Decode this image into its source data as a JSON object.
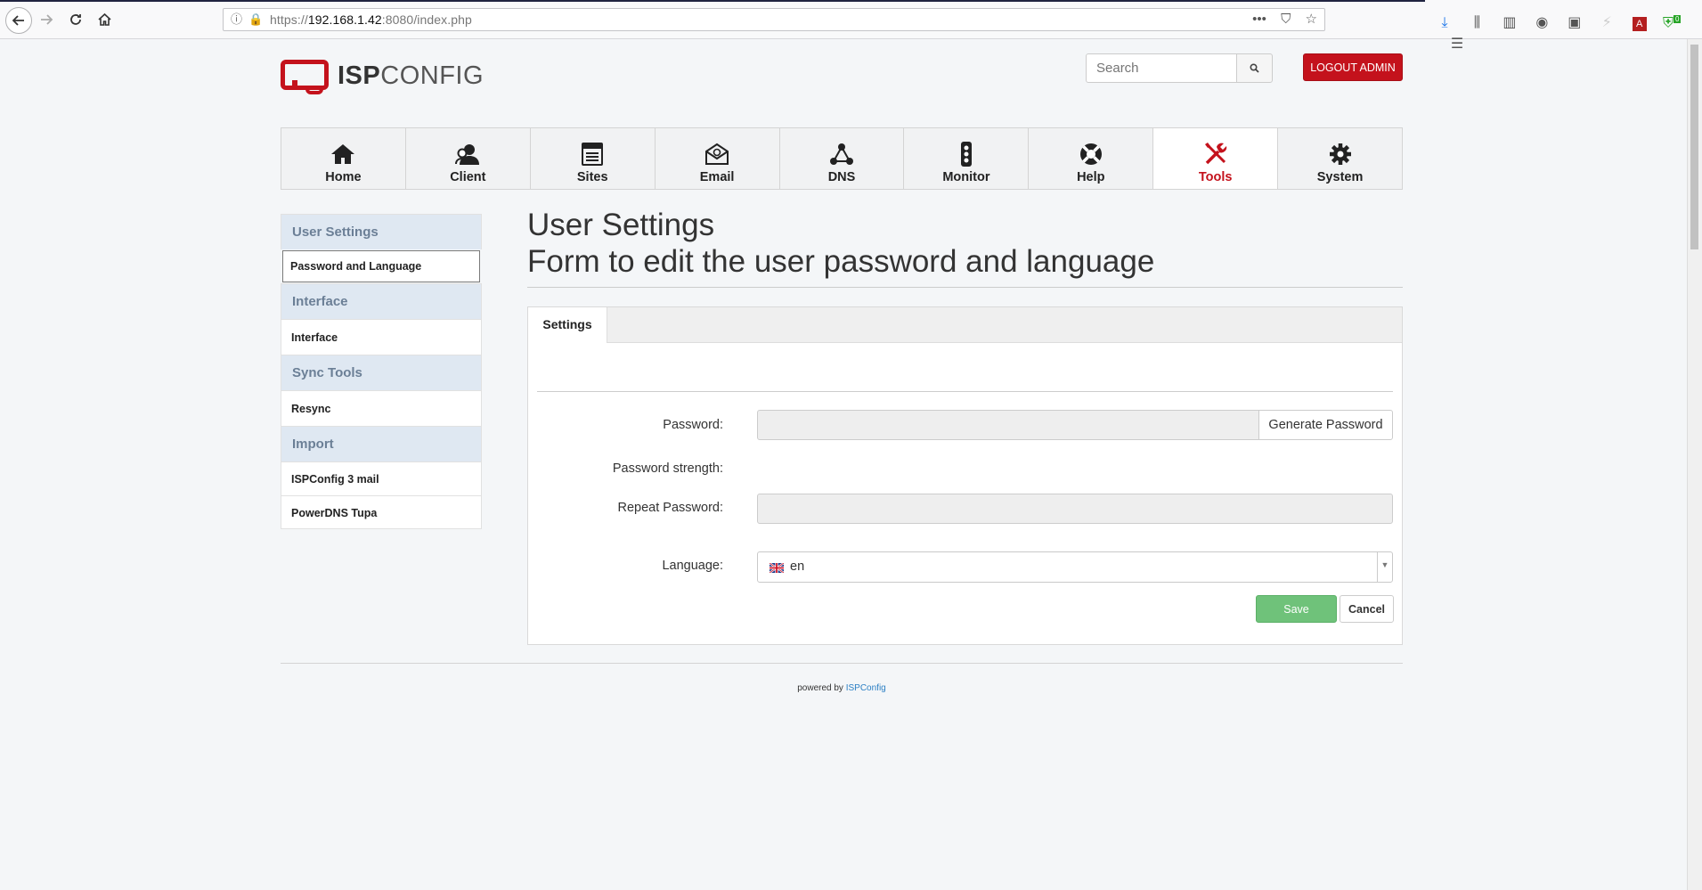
{
  "browser": {
    "url_prefix": "https://",
    "url_host": "192.168.1.42",
    "url_rest": ":8080/index.php",
    "more_icon": "ellipsis-icon",
    "pocket_icon": "pocket-icon",
    "bookmark_icon": "star-icon",
    "extension_badge": "0"
  },
  "header": {
    "logo_bold": "ISP",
    "logo_light": "CONFIG",
    "search_placeholder": "Search",
    "logout_label": "LOGOUT ADMIN"
  },
  "nav": [
    {
      "label": "Home",
      "icon": "home-icon"
    },
    {
      "label": "Client",
      "icon": "client-icon"
    },
    {
      "label": "Sites",
      "icon": "sites-icon"
    },
    {
      "label": "Email",
      "icon": "email-icon"
    },
    {
      "label": "DNS",
      "icon": "dns-icon"
    },
    {
      "label": "Monitor",
      "icon": "monitor-icon"
    },
    {
      "label": "Help",
      "icon": "help-icon"
    },
    {
      "label": "Tools",
      "icon": "tools-icon",
      "active": true
    },
    {
      "label": "System",
      "icon": "system-icon"
    }
  ],
  "sidebar": {
    "sections": [
      {
        "title": "User Settings",
        "items": [
          "Password and Language"
        ]
      },
      {
        "title": "Interface",
        "items": [
          "Interface"
        ]
      },
      {
        "title": "Sync Tools",
        "items": [
          "Resync"
        ]
      },
      {
        "title": "Import",
        "items": [
          "ISPConfig 3 mail",
          "PowerDNS Tupa"
        ]
      }
    ]
  },
  "page": {
    "title": "User Settings",
    "subtitle": "Form to edit the user password and language"
  },
  "form": {
    "tab": "Settings",
    "password_label": "Password:",
    "password_value": "",
    "generate_label": "Generate Password",
    "strength_label": "Password strength:",
    "repeat_label": "Repeat Password:",
    "repeat_value": "",
    "language_label": "Language:",
    "language_value": "en",
    "save_label": "Save",
    "cancel_label": "Cancel"
  },
  "footer": {
    "text": "powered by",
    "link": "ISPConfig"
  },
  "colors": {
    "brand_red": "#c4121c",
    "sidebar_header_bg": "#dfe8f2",
    "save_green": "#6fc27a"
  }
}
